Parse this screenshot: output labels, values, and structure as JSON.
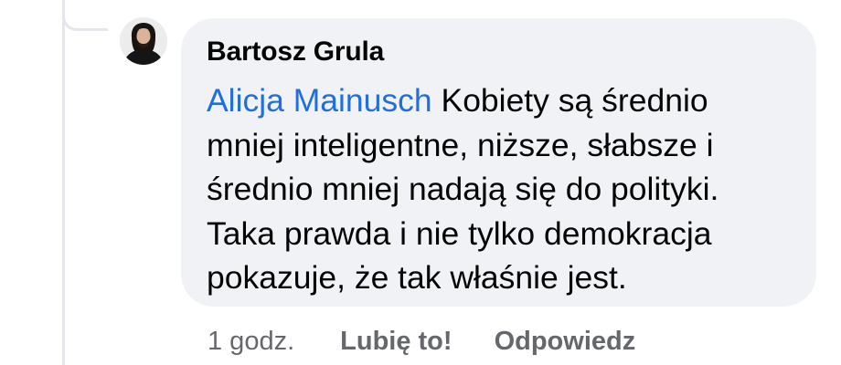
{
  "comment": {
    "author": "Bartosz Grula",
    "mention": "Alicja Mainusch",
    "text": "Kobiety są średnio mniej inteligentne, niższe, słabsze i średnio mniej nadają się do polityki. Taka prawda i nie tylko demokracja pokazuje, że tak właśnie jest."
  },
  "actions": {
    "timestamp": "1 godz.",
    "like_label": "Lubię to!",
    "reply_label": "Odpowiedz"
  },
  "colors": {
    "bubble_background": "#f0f2f5",
    "mention_blue": "#216fdb",
    "action_gray": "#65676b",
    "text_black": "#050505",
    "thread_line": "#e4e6eb"
  }
}
